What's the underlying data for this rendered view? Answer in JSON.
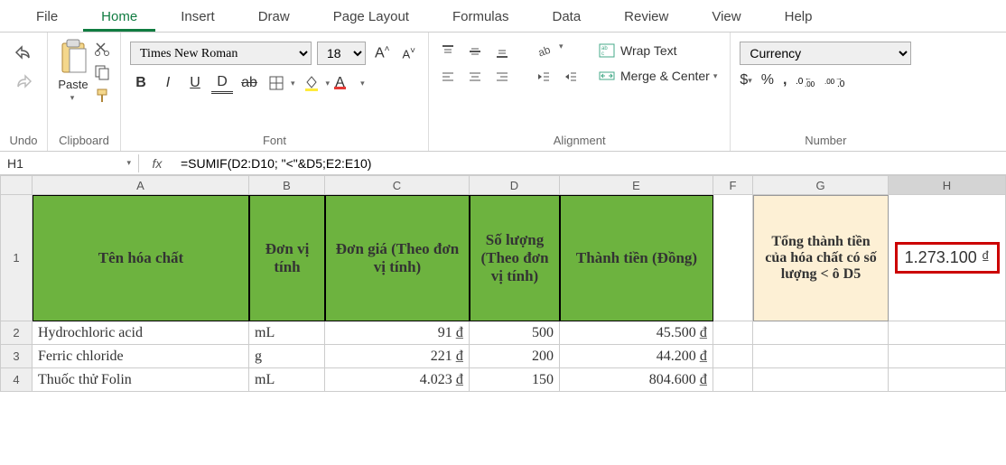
{
  "tabs": {
    "items": [
      "File",
      "Home",
      "Insert",
      "Draw",
      "Page Layout",
      "Formulas",
      "Data",
      "Review",
      "View",
      "Help"
    ],
    "active": "Home"
  },
  "clipboard": {
    "label": "Clipboard",
    "paste": "Paste"
  },
  "undo": {
    "label": "Undo"
  },
  "font": {
    "label": "Font",
    "family": "Times New Roman",
    "size": "18",
    "bold": "B",
    "italic": "I",
    "underline": "U",
    "dunder": "D"
  },
  "alignment": {
    "label": "Alignment",
    "wrap": "Wrap Text",
    "merge": "Merge & Center"
  },
  "number": {
    "label": "Number",
    "format": "Currency"
  },
  "formula_bar": {
    "cell": "H1",
    "fx": "fx",
    "formula": "=SUMIF(D2:D10; \"<\"&D5;E2:E10)"
  },
  "columns": [
    "A",
    "B",
    "C",
    "D",
    "E",
    "F",
    "G",
    "H"
  ],
  "header_row": {
    "A": "Tên hóa chất",
    "B": "Đơn vị tính",
    "C": "Đơn giá (Theo đơn vị tính)",
    "D": "Số lượng (Theo đơn vị tính)",
    "E": "Thành tiền (Đồng)",
    "G": "Tổng thành tiền của hóa chất có số lượng < ô D5",
    "H": "1.273.100 ₫"
  },
  "rows": [
    {
      "n": "2",
      "A": "Hydrochloric acid",
      "B": "mL",
      "C": "91 ₫",
      "D": "500",
      "E": "45.500 ₫"
    },
    {
      "n": "3",
      "A": "Ferric chloride",
      "B": "g",
      "C": "221 ₫",
      "D": "200",
      "E": "44.200 ₫"
    },
    {
      "n": "4",
      "A": "Thuốc thử Folin",
      "B": "mL",
      "C": "4.023 ₫",
      "D": "150",
      "E": "804.600 ₫"
    }
  ]
}
